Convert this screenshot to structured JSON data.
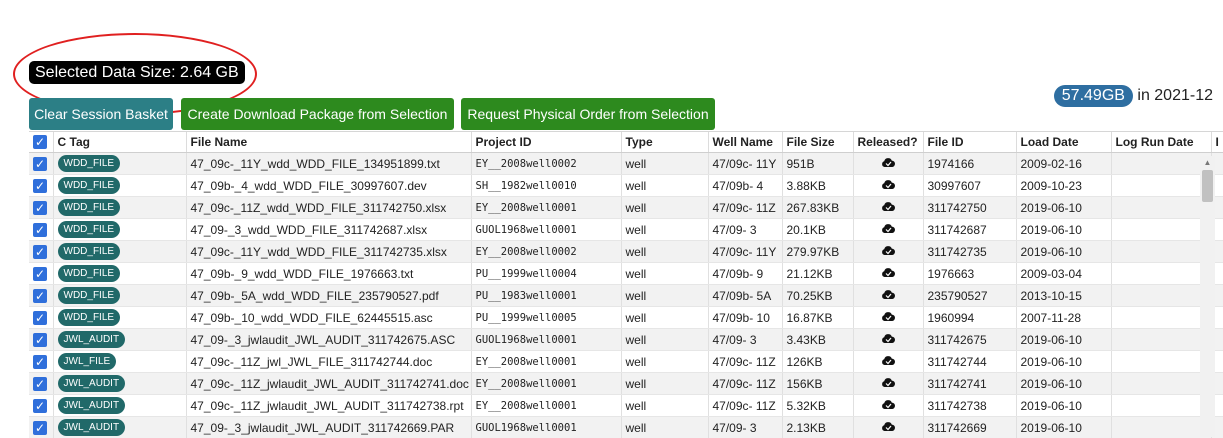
{
  "header": {
    "selected_size": "Selected Data Size: 2.64 GB",
    "total_gb": "57.49GB",
    "total_suffix": " in 2021-12"
  },
  "buttons": {
    "clear": "Clear Session Basket",
    "create": "Create Download Package from Selection",
    "request": "Request Physical Order from Selection"
  },
  "columns": [
    "C Tag",
    "File Name",
    "Project ID",
    "Type",
    "Well Name",
    "File Size",
    "Released?",
    "File ID",
    "Load Date",
    "Log Run Date",
    "I"
  ],
  "icons": {
    "checkbox": "checkbox-checked-icon",
    "released": "cloud-icon"
  },
  "colors": {
    "tag": "#216969",
    "checkbox": "#2f6fdb",
    "green_button": "#2d8a1e",
    "teal_button": "#2c7f86",
    "circle": "#e02020"
  },
  "rows": [
    {
      "tag": "WDD_FILE",
      "name": "47_09c-_11Y_wdd_WDD_FILE_134951899.txt",
      "project": "EY__2008well0002",
      "type": "well",
      "well": "47/09c- 11Y",
      "size": "951B",
      "id": "1974166",
      "load": "2009-02-16"
    },
    {
      "tag": "WDD_FILE",
      "name": "47_09b-_4_wdd_WDD_FILE_30997607.dev",
      "project": "SH__1982well0010",
      "type": "well",
      "well": "47/09b- 4",
      "size": "3.88KB",
      "id": "30997607",
      "load": "2009-10-23"
    },
    {
      "tag": "WDD_FILE",
      "name": "47_09c-_11Z_wdd_WDD_FILE_311742750.xlsx",
      "project": "EY__2008well0001",
      "type": "well",
      "well": "47/09c- 11Z",
      "size": "267.83KB",
      "id": "311742750",
      "load": "2019-06-10"
    },
    {
      "tag": "WDD_FILE",
      "name": "47_09-_3_wdd_WDD_FILE_311742687.xlsx",
      "project": "GUOL1968well0001",
      "type": "well",
      "well": "47/09- 3",
      "size": "20.1KB",
      "id": "311742687",
      "load": "2019-06-10"
    },
    {
      "tag": "WDD_FILE",
      "name": "47_09c-_11Y_wdd_WDD_FILE_311742735.xlsx",
      "project": "EY__2008well0002",
      "type": "well",
      "well": "47/09c- 11Y",
      "size": "279.97KB",
      "id": "311742735",
      "load": "2019-06-10"
    },
    {
      "tag": "WDD_FILE",
      "name": "47_09b-_9_wdd_WDD_FILE_1976663.txt",
      "project": "PU__1999well0004",
      "type": "well",
      "well": "47/09b- 9",
      "size": "21.12KB",
      "id": "1976663",
      "load": "2009-03-04"
    },
    {
      "tag": "WDD_FILE",
      "name": "47_09b-_5A_wdd_WDD_FILE_235790527.pdf",
      "project": "PU__1983well0001",
      "type": "well",
      "well": "47/09b- 5A",
      "size": "70.25KB",
      "id": "235790527",
      "load": "2013-10-15"
    },
    {
      "tag": "WDD_FILE",
      "name": "47_09b-_10_wdd_WDD_FILE_62445515.asc",
      "project": "PU__1999well0005",
      "type": "well",
      "well": "47/09b- 10",
      "size": "16.87KB",
      "id": "1960994",
      "load": "2007-11-28"
    },
    {
      "tag": "JWL_AUDIT",
      "name": "47_09-_3_jwlaudit_JWL_AUDIT_311742675.ASC",
      "project": "GUOL1968well0001",
      "type": "well",
      "well": "47/09- 3",
      "size": "3.43KB",
      "id": "311742675",
      "load": "2019-06-10"
    },
    {
      "tag": "JWL_FILE",
      "name": "47_09c-_11Z_jwl_JWL_FILE_311742744.doc",
      "project": "EY__2008well0001",
      "type": "well",
      "well": "47/09c- 11Z",
      "size": "126KB",
      "id": "311742744",
      "load": "2019-06-10"
    },
    {
      "tag": "JWL_AUDIT",
      "name": "47_09c-_11Z_jwlaudit_JWL_AUDIT_311742741.doc",
      "project": "EY__2008well0001",
      "type": "well",
      "well": "47/09c- 11Z",
      "size": "156KB",
      "id": "311742741",
      "load": "2019-06-10"
    },
    {
      "tag": "JWL_AUDIT",
      "name": "47_09c-_11Z_jwlaudit_JWL_AUDIT_311742738.rpt",
      "project": "EY__2008well0001",
      "type": "well",
      "well": "47/09c- 11Z",
      "size": "5.32KB",
      "id": "311742738",
      "load": "2019-06-10"
    },
    {
      "tag": "JWL_AUDIT",
      "name": "47_09-_3_jwlaudit_JWL_AUDIT_311742669.PAR",
      "project": "GUOL1968well0001",
      "type": "well",
      "well": "47/09- 3",
      "size": "2.13KB",
      "id": "311742669",
      "load": "2019-06-10"
    }
  ]
}
